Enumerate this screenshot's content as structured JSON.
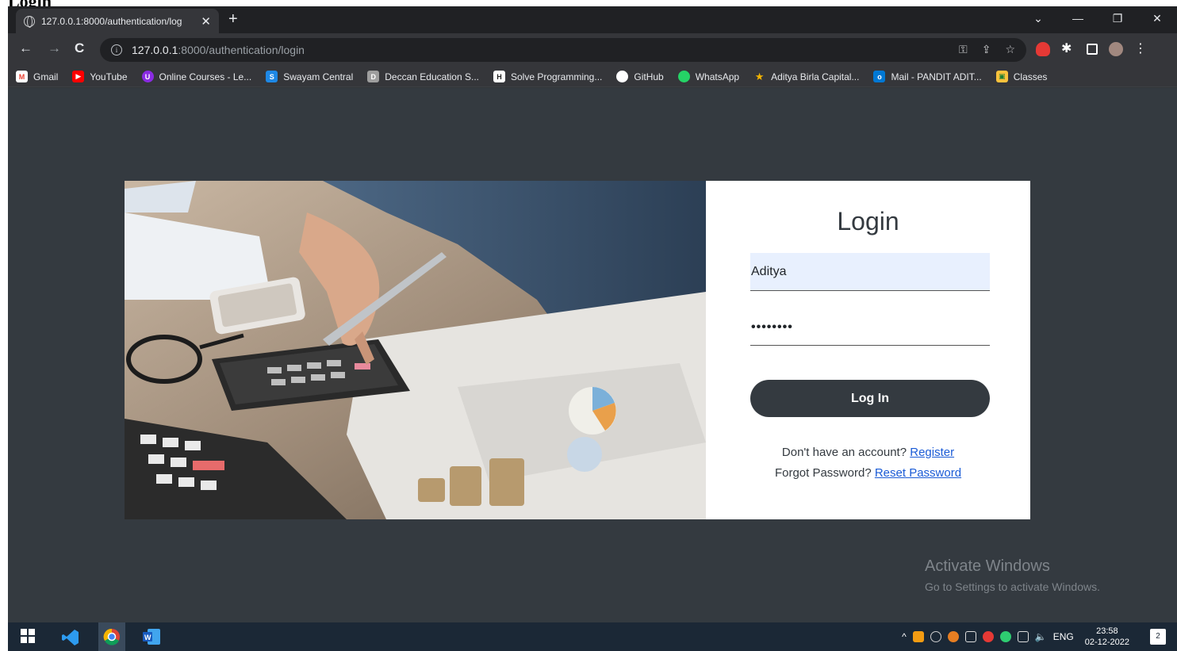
{
  "page_heading": "Login",
  "browser": {
    "tab_title": "127.0.0.1:8000/authentication/log",
    "url_host": "127.0.0.1",
    "url_rest": ":8000/authentication/login"
  },
  "bookmarks": [
    {
      "label": "Gmail",
      "color": "#ea4335",
      "glyph": "M"
    },
    {
      "label": "YouTube",
      "color": "#ff0000",
      "glyph": "▶"
    },
    {
      "label": "Online Courses - Le...",
      "color": "#8a2be2",
      "glyph": "U"
    },
    {
      "label": "Swayam Central",
      "color": "#1e88e5",
      "glyph": "S"
    },
    {
      "label": "Deccan Education S...",
      "color": "#9e9e9e",
      "glyph": "D"
    },
    {
      "label": "Solve Programming...",
      "color": "#222222",
      "glyph": "H"
    },
    {
      "label": "GitHub",
      "color": "#ffffff",
      "glyph": ""
    },
    {
      "label": "WhatsApp",
      "color": "#25d366",
      "glyph": ""
    },
    {
      "label": "Aditya Birla Capital...",
      "color": "#f4b400",
      "glyph": "★"
    },
    {
      "label": "Mail - PANDIT ADIT...",
      "color": "#0078d4",
      "glyph": "o"
    },
    {
      "label": "Classes",
      "color": "#34a853",
      "glyph": "▣"
    }
  ],
  "login": {
    "title": "Login",
    "username_value": "Aditya",
    "password_mask": "••••••••",
    "button_label": "Log In",
    "register_prompt": "Don't have an account?",
    "register_link": "Register",
    "forgot_prompt": "Forgot Password?",
    "reset_link": "Reset Password"
  },
  "watermark": {
    "title": "Activate Windows",
    "subtitle": "Go to Settings to activate Windows."
  },
  "taskbar": {
    "language": "ENG",
    "time": "23:58",
    "date": "02-12-2022",
    "notification_count": "2"
  }
}
